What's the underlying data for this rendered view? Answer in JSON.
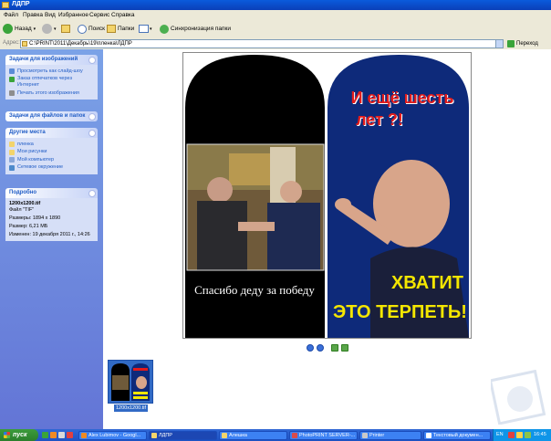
{
  "window": {
    "title": "ЛДПР"
  },
  "menu": [
    "Файл",
    "Правка",
    "Вид",
    "Избранное",
    "Сервис",
    "Справка"
  ],
  "toolbar": {
    "back_label": "Назад",
    "search_label": "Поиск",
    "folders_label": "Папки",
    "sync_label": "Синхронизация папки"
  },
  "address": {
    "label": "Адрес:",
    "value": "C:\\PRINT\\2011\\Декабрь\\19\\пленка\\ЛДПР",
    "go_label": "Переход"
  },
  "left_panels": {
    "image_tasks": {
      "title": "Задачи для изображений",
      "items": [
        "Просмотреть как слайд-шоу",
        "Заказ отпечатков через Интернет",
        "Печать этого изображения"
      ]
    },
    "file_tasks": {
      "title": "Задачи для файлов и папок"
    },
    "other_places": {
      "title": "Другие места",
      "items": [
        "пленка",
        "Мои рисунки",
        "Мой компьютер",
        "Сетевое окружение"
      ]
    },
    "details": {
      "title": "Подробно",
      "filename": "1200x1200.tif",
      "type": "Файл \"TIF\"",
      "dimensions": "Размеры: 1894 x 1890",
      "size": "Размер: 6,21 МБ",
      "modified": "Изменен: 19 декабря 2011 г., 14:26"
    }
  },
  "preview": {
    "left_caption": "Спасибо деду за победу",
    "right_top_line1": "И ещё шесть",
    "right_top_line2": "лет ?!",
    "right_bottom_line1": "ХВАТИТ",
    "right_bottom_line2": "ЭТО ТЕРПЕТЬ!"
  },
  "thumbnail": {
    "caption": "1200x1200.tif"
  },
  "taskbar": {
    "start_label": "пуск",
    "tasks": [
      "Alex Lubimov - Googl...",
      "ЛДПР",
      "Алешка",
      "PhotoPRINT SERVER-...",
      "Printer",
      "Текстовый докумен..."
    ],
    "tray_lang": "EN",
    "clock": "16:45"
  },
  "colors": {
    "titlebar": "#0a5bdc",
    "left_pane": "#7ba2e7",
    "poster_blue": "#0e2a7a",
    "poster_red": "#e21b1b",
    "poster_yellow": "#f4e600"
  }
}
